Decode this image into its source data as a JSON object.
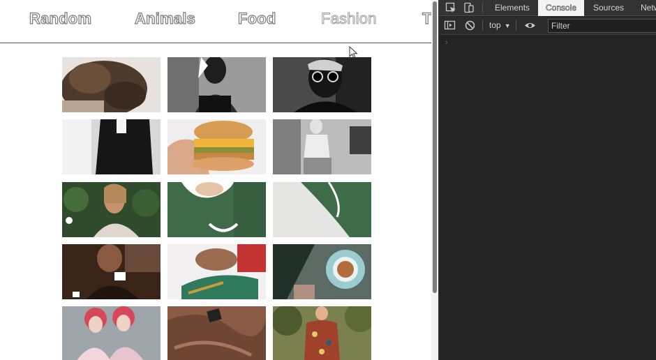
{
  "nav": {
    "items": [
      "Random",
      "Animals",
      "Food",
      "Fashion",
      "Tr"
    ]
  },
  "gallery": {
    "tiles": [
      {
        "subject": "curly hair"
      },
      {
        "subject": "portrait bw"
      },
      {
        "subject": "sunglasses bw"
      },
      {
        "subject": "black suit bw"
      },
      {
        "subject": "burger"
      },
      {
        "subject": "street fashion bw"
      },
      {
        "subject": "woman with plants"
      },
      {
        "subject": "green sweater"
      },
      {
        "subject": "green sweater detail"
      },
      {
        "subject": "woman at cafe"
      },
      {
        "subject": "woman lying down"
      },
      {
        "subject": "coffee cup"
      },
      {
        "subject": "pink hair duo"
      },
      {
        "subject": "brown fabric"
      },
      {
        "subject": "man in floral shirt"
      }
    ]
  },
  "devtools": {
    "tabs": [
      "Elements",
      "Console",
      "Sources",
      "Netw"
    ],
    "active_tab": "Console",
    "context": "top",
    "filter_placeholder": "Filter",
    "prompt": "›"
  }
}
